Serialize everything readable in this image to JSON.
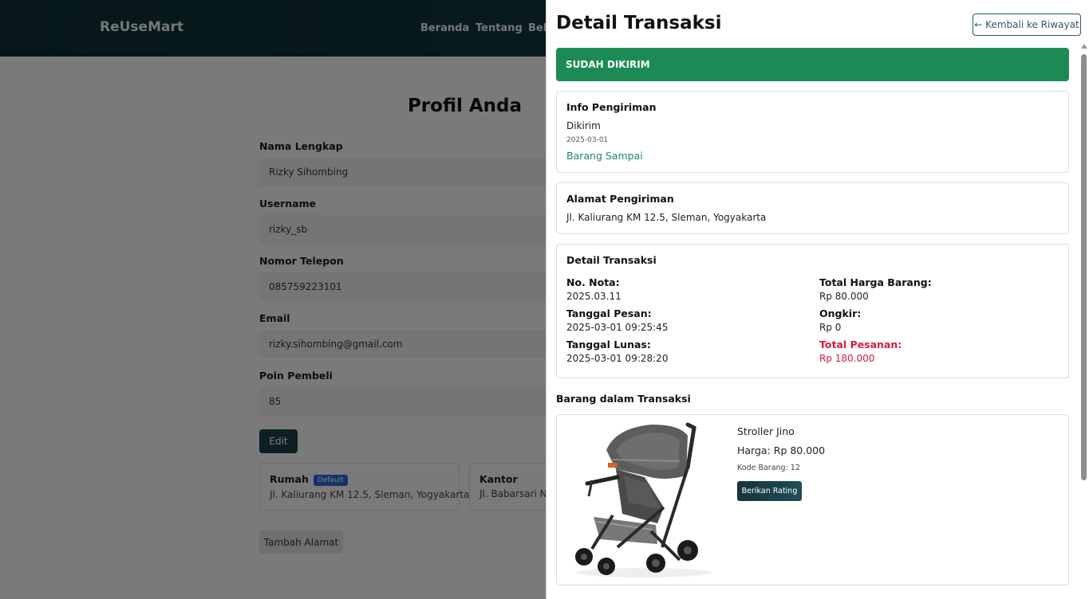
{
  "navbar": {
    "brand": "ReUseMart",
    "links": [
      "Beranda",
      "Tentang",
      "Bela"
    ]
  },
  "profile": {
    "title": "Profil Anda",
    "fields": [
      {
        "label": "Nama Lengkap",
        "value": "Rizky Sihombing"
      },
      {
        "label": "Username",
        "value": "rizky_sb"
      },
      {
        "label": "Nomor Telepon",
        "value": "085759223101"
      },
      {
        "label": "Email",
        "value": "rizky.sihombing@gmail.com"
      },
      {
        "label": "Poin Pembeli",
        "value": "85"
      }
    ],
    "edit_label": "Edit",
    "addresses": [
      {
        "name": "Rumah",
        "badge": "Default",
        "text": "Jl. Kaliurang KM 12.5, Sleman, Yogyakarta"
      },
      {
        "name": "Kantor",
        "text": "Jl. Babarsari No."
      }
    ],
    "add_address_label": "Tambah Alamat"
  },
  "drawer": {
    "title": "Detail Transaksi",
    "back_label": "← Kembali ke Riwayat",
    "status": "SUDAH DIKIRIM",
    "shipping": {
      "title": "Info Pengiriman",
      "status": "Dikirim",
      "date": "2025-03-01",
      "arrived": "Barang Sampai"
    },
    "address": {
      "title": "Alamat Pengiriman",
      "text": "Jl. Kaliurang KM 12.5, Sleman, Yogyakarta"
    },
    "detail": {
      "title": "Detail Transaksi",
      "left": [
        {
          "label": "No. Nota:",
          "value": "2025.03.11"
        },
        {
          "label": "Tanggal Pesan:",
          "value": "2025-03-01 09:25:45"
        },
        {
          "label": "Tanggal Lunas:",
          "value": "2025-03-01 09:28:20"
        }
      ],
      "right": [
        {
          "label": "Total Harga Barang:",
          "value": "Rp 80.000"
        },
        {
          "label": "Ongkir:",
          "value": "Rp 0"
        },
        {
          "label": "Total Pesanan:",
          "value": "Rp 180.000"
        }
      ]
    },
    "items_heading": "Barang dalam Transaksi",
    "items": [
      {
        "name": "Stroller Jino",
        "price": "Harga: Rp 80.000",
        "code": "Kode Barang: 12",
        "rate_label": "Berikan Rating"
      }
    ]
  },
  "colors": {
    "navbar": "#0d2d33",
    "status_green": "#1d8a56",
    "total_red": "#d0203c",
    "button_dark": "#1b3e45",
    "badge_blue": "#2a62d4"
  }
}
